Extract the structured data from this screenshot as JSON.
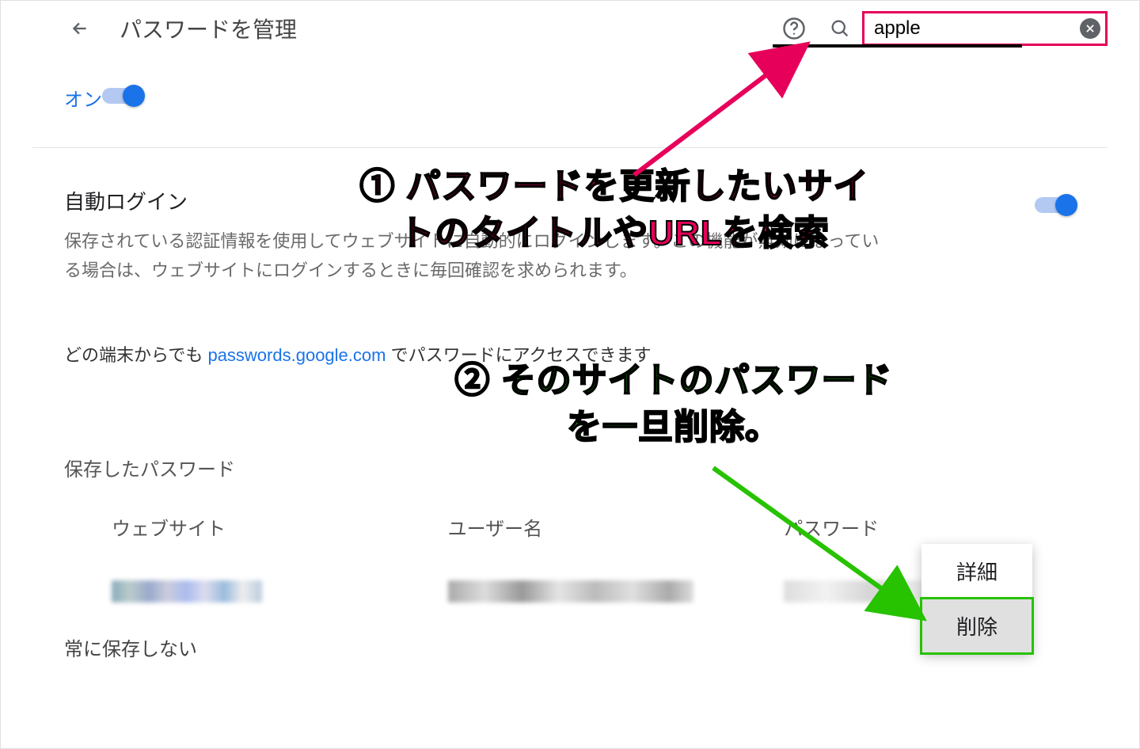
{
  "header": {
    "title": "パスワードを管理",
    "search_value": "apple"
  },
  "settings": {
    "on_label": "オン",
    "auto_login_title": "自動ログイン",
    "auto_login_desc": "保存されている認証情報を使用してウェブサイトに自動的にログインします。この機能が無効になっている場合は、ウェブサイトにログインするときに毎回確認を求められます。"
  },
  "info": {
    "prefix": "どの端末からでも ",
    "link_text": "passwords.google.com",
    "suffix": " でパスワードにアクセスできます"
  },
  "table": {
    "saved_title": "保存したパスワード",
    "col_site": "ウェブサイト",
    "col_user": "ユーザー名",
    "col_pass": "パスワード"
  },
  "menu": {
    "details": "詳細",
    "delete": "削除"
  },
  "never_save_title": "常に保存しない",
  "annotations": {
    "step1": "① パスワードを更新したいサイトのタイトルやURLを検索",
    "step2": "② そのサイトのパスワードを一旦削除。"
  }
}
